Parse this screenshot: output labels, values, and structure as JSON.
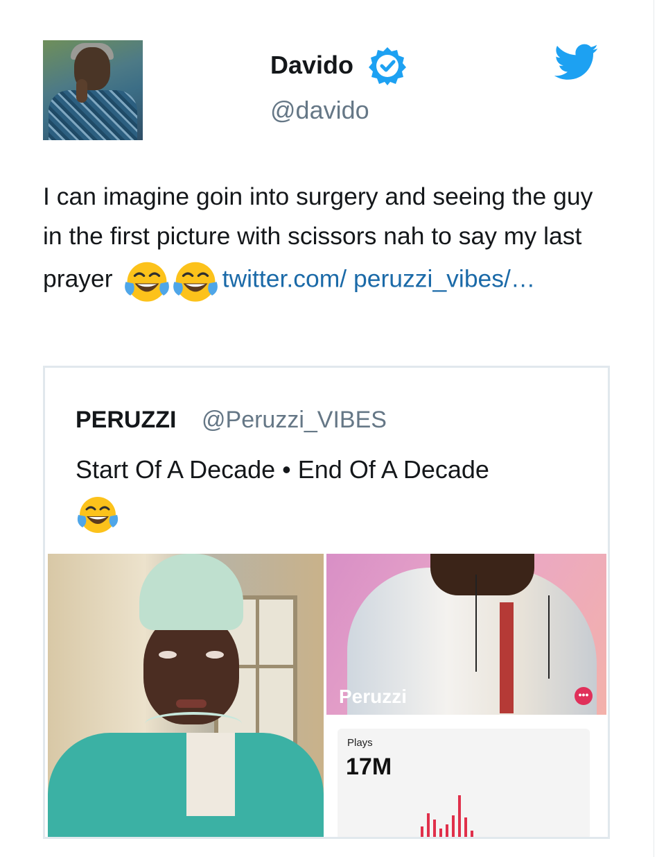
{
  "tweet": {
    "author_name": "Davido",
    "author_handle": "@davido",
    "text_before_emoji": "I can imagine goin into surgery and seeing the guy in the first picture with scissors nah to say my last prayer",
    "link_text": "twitter.com/ peruzzi_vibes/…",
    "emojis": [
      "face-with-tears-of-joy",
      "face-with-tears-of-joy"
    ],
    "brand_color": "#1da1f2",
    "link_color": "#1b6aa8"
  },
  "quoted": {
    "author_name": "PERUZZI",
    "author_handle": "@Peruzzi_VIBES",
    "text": "Start Of A Decade • End Of A Decade",
    "emoji": "face-with-tears-of-joy",
    "right_image": {
      "artist_label": "Peruzzi",
      "stat_label": "Plays",
      "stat_value": "17M",
      "bar_levels": [
        0.3,
        0.6,
        0.45,
        0.25,
        0.35,
        0.55,
        1.0,
        0.5,
        0.2
      ]
    }
  }
}
